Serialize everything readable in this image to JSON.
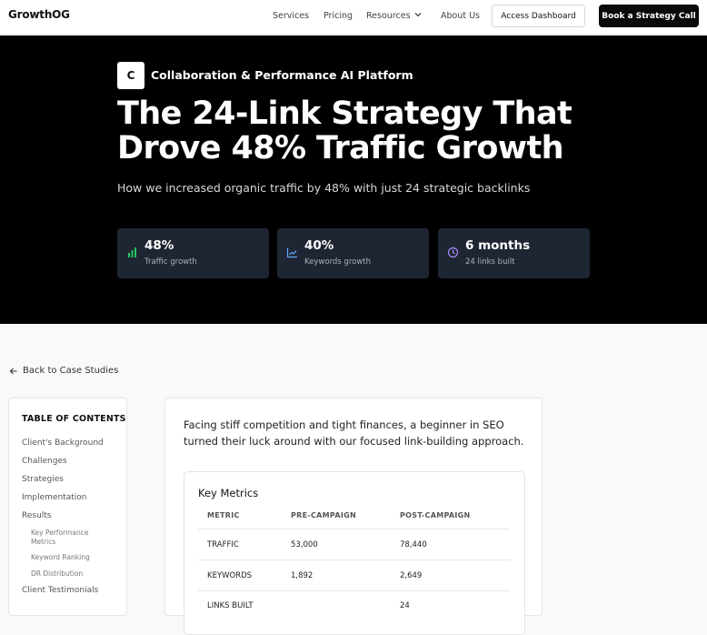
{
  "nav": {
    "brand": "GrowthOG",
    "links": [
      "Services",
      "Pricing",
      "Resources",
      "About Us"
    ],
    "dashboard_label": "Access Dashboard",
    "cta_label": "Book a Strategy Call"
  },
  "hero": {
    "badge_letter": "C",
    "badge_text": "Collaboration & Performance AI Platform",
    "title_line1": "The 24-Link Strategy That",
    "title_line2": "Drove 48% Traffic Growth",
    "subtitle": "How we increased organic traffic by 48% with just 24 strategic backlinks",
    "stats": [
      {
        "value": "48%",
        "label": "Traffic growth",
        "icon": "bar-chart-icon",
        "color": "#22c55e"
      },
      {
        "value": "40%",
        "label": "Keywords growth",
        "icon": "line-chart-icon",
        "color": "#60a5fa"
      },
      {
        "value": "6 months",
        "label": "24 links built",
        "icon": "clock-icon",
        "color": "#a78bfa"
      }
    ]
  },
  "back_label": "Back to Case Studies",
  "toc": {
    "title": "TABLE OF CONTENTS",
    "items": [
      "Client's Background",
      "Challenges",
      "Strategies",
      "Implementation",
      "Results"
    ],
    "sub_items": [
      "Key Performance Metrics",
      "Keyword Ranking",
      "DR Distribution"
    ],
    "last_item": "Client Testimonials"
  },
  "content": {
    "intro": "Facing stiff competition and tight finances, a beginner in SEO turned their luck around with our focused link-building approach.",
    "metrics_title": "Key Metrics",
    "columns": [
      "METRIC",
      "PRE-CAMPAIGN",
      "POST-CAMPAIGN"
    ],
    "rows": [
      [
        "TRAFFIC",
        "53,000",
        "78,440"
      ],
      [
        "KEYWORDS",
        "1,892",
        "2,649"
      ],
      [
        "LINKS BUILT",
        "",
        "24"
      ]
    ]
  }
}
